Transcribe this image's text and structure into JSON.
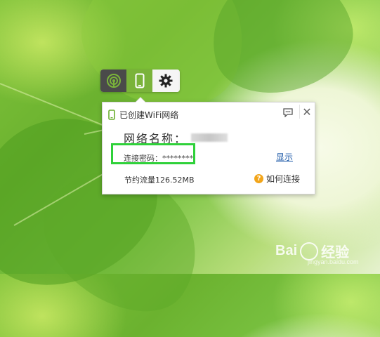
{
  "toolbar": {
    "tabs": [
      {
        "name": "wifi-hotspot-icon",
        "active": true
      },
      {
        "name": "phone-icon",
        "active": false
      },
      {
        "name": "gear-icon",
        "active": false
      }
    ]
  },
  "popup": {
    "title": "已创建WiFi网络",
    "network_label": "网络名称：",
    "password_label": "连接密码：",
    "password_value": "********",
    "show_link": "显示",
    "traffic_label": "节约流量",
    "traffic_value": "126.52MB",
    "help_label": "如何连接",
    "close": "✕"
  },
  "watermark": {
    "brand": "Bai",
    "brand2": "经验",
    "url": "jingyan.baidu.com"
  },
  "colors": {
    "accent_green": "#7ab33a",
    "highlight_box": "#2fd13a",
    "link_blue": "#1e5aa8",
    "help_orange": "#f2a51a"
  }
}
